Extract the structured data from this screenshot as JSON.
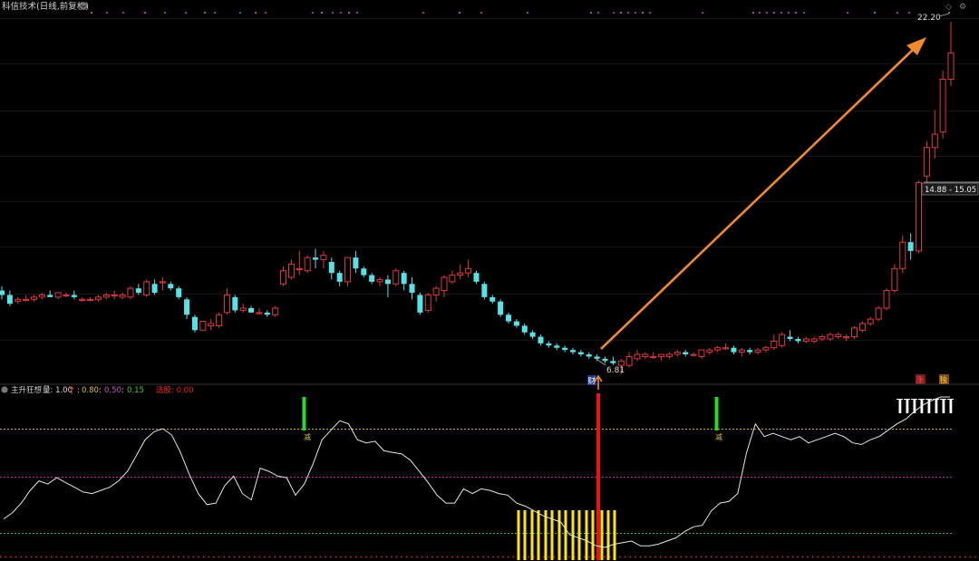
{
  "header": {
    "title": "科信技术(日线,前复权)"
  },
  "price_labels": {
    "high": "22.20",
    "low": "6.81",
    "range": "14.88 - 15.05"
  },
  "markers": {
    "cai": "财",
    "zhang": "涨",
    "du": "独",
    "jian_1": "减",
    "jian_2": "减"
  },
  "indicator": {
    "name": "主升狂想",
    "liang_label": "量: 1.00",
    "v1": "0.80",
    "v2": "0.50",
    "v3": "0.15",
    "select_label": "选股: 0.00"
  },
  "colors": {
    "up": "#e03a3a",
    "down": "#55e3e8",
    "arrow": "#f08a2c",
    "yellow": "#ffe600",
    "green_bar": "#22dd22",
    "red_bar": "#ee1111",
    "magenta": "#e040e0"
  },
  "chart_data": [
    {
      "type": "candlestick",
      "title": "科信技术(日线,前复权)",
      "annotations": [
        "22.20",
        "6.81",
        "14.88 - 15.05"
      ],
      "ylim": [
        5.7,
        23.2
      ],
      "candles": [
        [
          10.0,
          10.2,
          9.6,
          9.8
        ],
        [
          9.8,
          10.0,
          9.3,
          9.4
        ],
        [
          9.5,
          9.7,
          9.4,
          9.6
        ],
        [
          9.6,
          9.8,
          9.5,
          9.6
        ],
        [
          9.6,
          9.8,
          9.5,
          9.7
        ],
        [
          9.7,
          9.9,
          9.6,
          9.8
        ],
        [
          9.8,
          10.0,
          9.7,
          9.7
        ],
        [
          9.7,
          9.9,
          9.6,
          9.9
        ],
        [
          9.8,
          9.9,
          9.7,
          9.8
        ],
        [
          9.8,
          10.0,
          9.6,
          9.7
        ],
        [
          9.6,
          9.7,
          9.5,
          9.6
        ],
        [
          9.6,
          9.7,
          9.5,
          9.6
        ],
        [
          9.6,
          9.8,
          9.5,
          9.7
        ],
        [
          9.7,
          9.9,
          9.6,
          9.8
        ],
        [
          9.8,
          10.0,
          9.6,
          9.8
        ],
        [
          9.7,
          9.9,
          9.6,
          9.8
        ],
        [
          9.7,
          10.2,
          9.6,
          10.1
        ],
        [
          10.1,
          10.3,
          9.8,
          9.9
        ],
        [
          9.8,
          10.5,
          9.7,
          10.4
        ],
        [
          10.3,
          10.5,
          9.8,
          9.9
        ],
        [
          10.4,
          10.6,
          10.0,
          10.4
        ],
        [
          10.3,
          10.4,
          10.0,
          10.1
        ],
        [
          10.1,
          10.2,
          9.6,
          9.7
        ],
        [
          9.6,
          9.7,
          8.7,
          8.9
        ],
        [
          8.8,
          8.9,
          8.1,
          8.2
        ],
        [
          8.2,
          8.6,
          8.2,
          8.6
        ],
        [
          8.4,
          8.7,
          8.2,
          8.5
        ],
        [
          8.4,
          9.0,
          8.3,
          8.9
        ],
        [
          9.0,
          10.1,
          8.9,
          9.8
        ],
        [
          9.7,
          9.8,
          9.0,
          9.1
        ],
        [
          9.1,
          9.4,
          9.0,
          9.2
        ],
        [
          9.2,
          9.3,
          9.0,
          9.0
        ],
        [
          9.0,
          9.2,
          8.9,
          9.0
        ],
        [
          9.0,
          9.1,
          8.8,
          8.9
        ],
        [
          8.9,
          9.3,
          8.8,
          9.2
        ],
        [
          10.3,
          11.1,
          10.2,
          10.9
        ],
        [
          10.6,
          11.4,
          10.5,
          11.2
        ],
        [
          11.0,
          11.8,
          10.7,
          11.0
        ],
        [
          10.9,
          11.6,
          10.8,
          11.5
        ],
        [
          11.5,
          11.9,
          11.0,
          11.4
        ],
        [
          11.4,
          11.8,
          11.0,
          11.6
        ],
        [
          11.3,
          11.5,
          10.5,
          10.8
        ],
        [
          10.8,
          10.9,
          10.2,
          10.4
        ],
        [
          10.4,
          11.4,
          10.2,
          11.5
        ],
        [
          11.5,
          11.8,
          10.8,
          11.0
        ],
        [
          11.0,
          11.1,
          10.6,
          10.7
        ],
        [
          10.7,
          10.8,
          10.3,
          10.4
        ],
        [
          10.4,
          10.6,
          10.2,
          10.5
        ],
        [
          10.5,
          10.7,
          9.7,
          10.3
        ],
        [
          10.3,
          11.0,
          10.2,
          10.9
        ],
        [
          10.8,
          10.9,
          10.0,
          10.3
        ],
        [
          10.3,
          10.6,
          9.6,
          9.9
        ],
        [
          9.8,
          9.9,
          8.9,
          9.0
        ],
        [
          9.1,
          9.9,
          9.0,
          9.8
        ],
        [
          9.8,
          10.2,
          9.5,
          10.1
        ],
        [
          10.0,
          10.7,
          9.7,
          10.6
        ],
        [
          10.4,
          10.9,
          10.3,
          10.7
        ],
        [
          10.7,
          11.2,
          10.5,
          10.8
        ],
        [
          10.8,
          11.4,
          10.6,
          11.0
        ],
        [
          10.8,
          10.9,
          10.3,
          10.4
        ],
        [
          10.3,
          10.4,
          9.6,
          9.7
        ],
        [
          9.7,
          9.8,
          9.4,
          9.5
        ],
        [
          9.5,
          9.6,
          8.8,
          8.9
        ],
        [
          8.9,
          9.0,
          8.5,
          8.6
        ],
        [
          8.6,
          8.7,
          8.3,
          8.4
        ],
        [
          8.4,
          8.5,
          8.0,
          8.1
        ],
        [
          8.1,
          8.2,
          7.8,
          7.9
        ],
        [
          7.9,
          8.0,
          7.5,
          7.6
        ],
        [
          7.6,
          7.7,
          7.4,
          7.5
        ],
        [
          7.5,
          7.6,
          7.3,
          7.4
        ],
        [
          7.4,
          7.5,
          7.2,
          7.3
        ],
        [
          7.3,
          7.4,
          7.1,
          7.2
        ],
        [
          7.2,
          7.3,
          7.0,
          7.1
        ],
        [
          7.1,
          7.2,
          6.9,
          7.0
        ],
        [
          7.0,
          7.1,
          6.8,
          6.9
        ],
        [
          6.9,
          7.0,
          6.7,
          6.8
        ],
        [
          6.8,
          7.0,
          6.6,
          6.7
        ],
        [
          6.6,
          6.9,
          6.2,
          6.8
        ],
        [
          6.6,
          7.2,
          6.5,
          7.0
        ],
        [
          6.9,
          7.3,
          6.8,
          7.1
        ],
        [
          7.0,
          7.2,
          6.9,
          7.1
        ],
        [
          7.0,
          7.2,
          6.9,
          7.0
        ],
        [
          7.0,
          7.1,
          6.8,
          7.1
        ],
        [
          7.0,
          7.2,
          6.9,
          7.1
        ],
        [
          7.1,
          7.3,
          7.0,
          7.2
        ],
        [
          7.2,
          7.3,
          7.0,
          7.1
        ],
        [
          7.1,
          7.2,
          7.0,
          7.1
        ],
        [
          7.0,
          7.3,
          6.9,
          7.3
        ],
        [
          7.2,
          7.4,
          7.1,
          7.3
        ],
        [
          7.3,
          7.5,
          7.2,
          7.4
        ],
        [
          7.4,
          7.6,
          7.3,
          7.4
        ],
        [
          7.4,
          7.5,
          7.1,
          7.2
        ],
        [
          7.2,
          7.4,
          7.0,
          7.3
        ],
        [
          7.3,
          7.4,
          7.1,
          7.2
        ],
        [
          7.2,
          7.4,
          7.1,
          7.3
        ],
        [
          7.3,
          7.5,
          7.2,
          7.4
        ],
        [
          7.4,
          8.0,
          7.3,
          7.7
        ],
        [
          7.5,
          8.1,
          7.4,
          8.0
        ],
        [
          7.9,
          8.2,
          7.7,
          7.8
        ],
        [
          7.8,
          7.9,
          7.6,
          7.7
        ],
        [
          7.7,
          7.9,
          7.6,
          7.8
        ],
        [
          7.7,
          7.9,
          7.6,
          7.8
        ],
        [
          7.8,
          8.0,
          7.7,
          7.9
        ],
        [
          7.8,
          8.1,
          7.7,
          8.0
        ],
        [
          7.9,
          8.1,
          7.8,
          8.0
        ],
        [
          7.9,
          8.0,
          7.7,
          7.9
        ],
        [
          7.9,
          8.4,
          7.8,
          8.3
        ],
        [
          8.2,
          8.6,
          8.1,
          8.5
        ],
        [
          8.5,
          8.8,
          8.4,
          8.7
        ],
        [
          8.7,
          9.3,
          8.6,
          9.2
        ],
        [
          9.2,
          10.1,
          9.1,
          10.0
        ],
        [
          10.0,
          11.2,
          9.9,
          11.0
        ],
        [
          11.0,
          12.5,
          10.8,
          12.2
        ],
        [
          12.2,
          12.6,
          11.4,
          11.8
        ],
        [
          11.8,
          15.0,
          11.7,
          14.9
        ],
        [
          15.2,
          16.8,
          14.6,
          16.5
        ],
        [
          16.5,
          18.2,
          16.0,
          17.1
        ],
        [
          17.2,
          20.0,
          16.9,
          19.6
        ],
        [
          19.6,
          22.2,
          19.3,
          20.8
        ]
      ]
    },
    {
      "type": "line",
      "title": "主升狂想",
      "annotations": [
        "量: 1.00",
        "0.80",
        "0.50",
        "0.15",
        "选股: 0.00"
      ],
      "ylim": [
        -0.06,
        0.97
      ],
      "reference_lines": [
        0.8,
        0.5,
        0.15
      ],
      "series": [
        {
          "values": [
            0.2,
            0.24,
            0.3,
            0.38,
            0.44,
            0.42,
            0.46,
            0.43,
            0.4,
            0.37,
            0.36,
            0.38,
            0.4,
            0.44,
            0.5,
            0.6,
            0.7,
            0.75,
            0.77,
            0.73,
            0.62,
            0.48,
            0.36,
            0.29,
            0.3,
            0.41,
            0.47,
            0.36,
            0.32,
            0.52,
            0.5,
            0.47,
            0.46,
            0.35,
            0.42,
            0.55,
            0.7,
            0.76,
            0.82,
            0.8,
            0.7,
            0.68,
            0.69,
            0.63,
            0.62,
            0.61,
            0.57,
            0.5,
            0.43,
            0.35,
            0.3,
            0.3,
            0.39,
            0.36,
            0.39,
            0.38,
            0.36,
            0.35,
            0.3,
            0.28,
            0.25,
            0.22,
            0.2,
            0.18,
            0.1,
            0.08,
            0.06,
            0.03,
            0.02,
            0.04,
            0.05,
            0.06,
            0.03,
            0.03,
            0.04,
            0.06,
            0.08,
            0.12,
            0.15,
            0.16,
            0.25,
            0.3,
            0.31,
            0.36,
            0.62,
            0.8,
            0.72,
            0.74,
            0.72,
            0.7,
            0.72,
            0.68,
            0.7,
            0.72,
            0.74,
            0.72,
            0.68,
            0.67,
            0.7,
            0.72,
            0.76,
            0.8,
            0.83,
            0.88,
            0.92,
            0.95,
            0.97,
            0.97
          ]
        }
      ]
    }
  ]
}
